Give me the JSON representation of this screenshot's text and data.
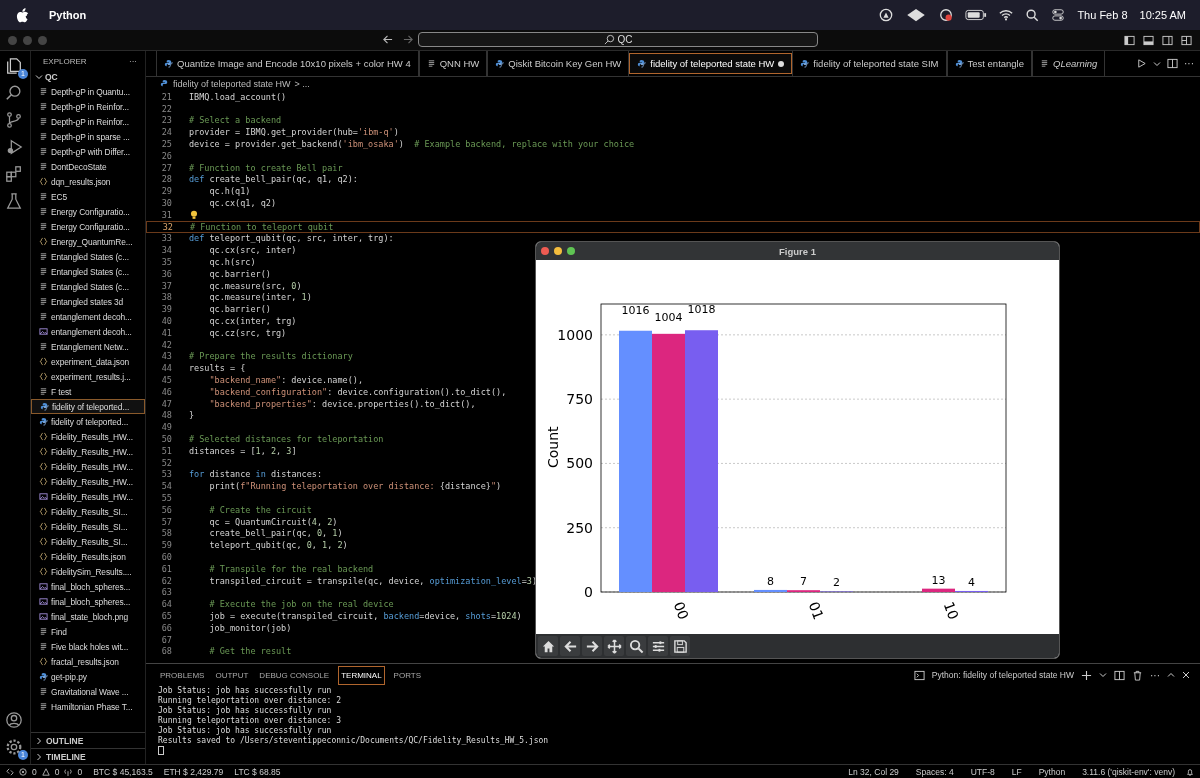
{
  "menubar": {
    "app": "Python",
    "date": "Thu Feb 8",
    "time": "10:25 AM"
  },
  "titlebar": {
    "search": "QC"
  },
  "activity_bar": {
    "explorer_badge": "1",
    "settings_badge": "1"
  },
  "explorer": {
    "title": "EXPLORER",
    "more": "···",
    "folder": "QC",
    "sections": [
      "OUTLINE",
      "TIMELINE"
    ],
    "items": [
      {
        "label": "Depth-ϱP in Quantu...",
        "kind": "file",
        "selected": false
      },
      {
        "label": "Depth-ϱP in Reinfor...",
        "kind": "file",
        "selected": false
      },
      {
        "label": "Depth-ϱP in Reinfor...",
        "kind": "file",
        "selected": false
      },
      {
        "label": "Depth-ϱP in sparse ...",
        "kind": "file",
        "selected": false
      },
      {
        "label": "Depth-ϱP with Differ...",
        "kind": "file",
        "selected": false
      },
      {
        "label": "DontDecoState",
        "kind": "file",
        "selected": false
      },
      {
        "label": "dqn_results.json",
        "kind": "json",
        "selected": false
      },
      {
        "label": "EC5",
        "kind": "file",
        "selected": false
      },
      {
        "label": "Energy Configuratio...",
        "kind": "file",
        "selected": false
      },
      {
        "label": "Energy Configuratio...",
        "kind": "file",
        "selected": false
      },
      {
        "label": "Energy_QuantumRe...",
        "kind": "json",
        "selected": false
      },
      {
        "label": "Entangled States (c...",
        "kind": "file",
        "selected": false
      },
      {
        "label": "Entangled States (c...",
        "kind": "file",
        "selected": false
      },
      {
        "label": "Entangled States (c...",
        "kind": "file",
        "selected": false
      },
      {
        "label": "Entangled states 3d",
        "kind": "file",
        "selected": false
      },
      {
        "label": "entanglement decoh...",
        "kind": "file",
        "selected": false
      },
      {
        "label": "entanglement decoh...",
        "kind": "image",
        "selected": false
      },
      {
        "label": "Entanglement Netw...",
        "kind": "file",
        "selected": false
      },
      {
        "label": "experiment_data.json",
        "kind": "json",
        "selected": false
      },
      {
        "label": "experiment_results.j...",
        "kind": "json",
        "selected": false
      },
      {
        "label": "F test",
        "kind": "file",
        "selected": false
      },
      {
        "label": "fidelity of teleported...",
        "kind": "python",
        "selected": true
      },
      {
        "label": "fidelity of teleported...",
        "kind": "python",
        "selected": false
      },
      {
        "label": "Fidelity_Results_HW...",
        "kind": "json",
        "selected": false
      },
      {
        "label": "Fidelity_Results_HW...",
        "kind": "json",
        "selected": false
      },
      {
        "label": "Fidelity_Results_HW...",
        "kind": "json",
        "selected": false
      },
      {
        "label": "Fidelity_Results_HW...",
        "kind": "json",
        "selected": false
      },
      {
        "label": "Fidelity_Results_HW...",
        "kind": "image",
        "selected": false
      },
      {
        "label": "Fidelity_Results_SI...",
        "kind": "json",
        "selected": false
      },
      {
        "label": "Fidelity_Results_SI...",
        "kind": "json",
        "selected": false
      },
      {
        "label": "Fidelity_Results_SI...",
        "kind": "json",
        "selected": false
      },
      {
        "label": "Fidelity_Results.json",
        "kind": "json",
        "selected": false
      },
      {
        "label": "FidelitySim_Results....",
        "kind": "json",
        "selected": false
      },
      {
        "label": "final_bloch_spheres...",
        "kind": "image",
        "selected": false
      },
      {
        "label": "final_bloch_spheres...",
        "kind": "image",
        "selected": false
      },
      {
        "label": "final_state_bloch.png",
        "kind": "image",
        "selected": false
      },
      {
        "label": "Find",
        "kind": "file",
        "selected": false
      },
      {
        "label": "Five black holes wit...",
        "kind": "file",
        "selected": false
      },
      {
        "label": "fractal_results.json",
        "kind": "json",
        "selected": false
      },
      {
        "label": "get-pip.py",
        "kind": "python",
        "selected": false
      },
      {
        "label": "Gravitational Wave ...",
        "kind": "file",
        "selected": false
      },
      {
        "label": "Hamiltonian Phase T...",
        "kind": "file",
        "selected": false
      }
    ]
  },
  "tabs": [
    {
      "label": "Quantize Image and Encode 10x10 pixels + color HW 4",
      "kind": "python",
      "selected": false,
      "modified": false,
      "preview": false
    },
    {
      "label": "QNN HW",
      "kind": "file",
      "selected": false,
      "modified": false,
      "preview": false
    },
    {
      "label": "Qiskit Bitcoin Key Gen HW",
      "kind": "python",
      "selected": false,
      "modified": false,
      "preview": false
    },
    {
      "label": "fidelity of teleported state HW",
      "kind": "python",
      "selected": true,
      "modified": true,
      "preview": false
    },
    {
      "label": "fidelity of teleported state SIM",
      "kind": "python",
      "selected": false,
      "modified": false,
      "preview": false
    },
    {
      "label": "Test entangle",
      "kind": "python",
      "selected": false,
      "modified": false,
      "preview": false
    },
    {
      "label": "QLearning",
      "kind": "file",
      "selected": false,
      "modified": false,
      "preview": true
    }
  ],
  "editor_more": "···",
  "breadcrumb": {
    "file": "fidelity of teleported state HW",
    "rest": "> ..."
  },
  "code": [
    {
      "number": "21",
      "current": false,
      "tokens": [
        {
          "kind": "plain",
          "text": "IBMQ.load_account()"
        }
      ]
    },
    {
      "number": "22",
      "current": false
    },
    {
      "number": "23",
      "current": false,
      "tokens": [
        {
          "kind": "comment",
          "text": "# Select a backend"
        }
      ]
    },
    {
      "number": "24",
      "current": false,
      "tokens": [
        {
          "kind": "plain",
          "text": "provider = IBMQ.get_provider(hub="
        },
        {
          "kind": "string",
          "text": "'ibm-q'"
        },
        {
          "kind": "plain",
          "text": ")"
        }
      ]
    },
    {
      "number": "25",
      "current": false,
      "tokens": [
        {
          "kind": "plain",
          "text": "device = provider.get_backend("
        },
        {
          "kind": "string",
          "text": "'ibm_osaka'"
        },
        {
          "kind": "plain",
          "text": ")  "
        },
        {
          "kind": "comment",
          "text": "# Example backend, replace with your choice"
        }
      ]
    },
    {
      "number": "26",
      "current": false
    },
    {
      "number": "27",
      "current": false,
      "tokens": [
        {
          "kind": "comment",
          "text": "# Function to create Bell pair"
        }
      ]
    },
    {
      "number": "28",
      "current": false,
      "tokens": [
        {
          "kind": "keyword",
          "text": "def "
        },
        {
          "kind": "plain",
          "text": "create_bell_pair(qc, q1, q2):"
        }
      ]
    },
    {
      "number": "29",
      "current": false,
      "tokens": [
        {
          "kind": "plain",
          "text": "    qc.h(q1)"
        }
      ]
    },
    {
      "number": "30",
      "current": false,
      "tokens": [
        {
          "kind": "plain",
          "text": "    qc.cx(q1, q2)"
        }
      ]
    },
    {
      "number": "31",
      "current": false,
      "bulb": true
    },
    {
      "number": "32",
      "current": true,
      "tokens": [
        {
          "kind": "comment",
          "text": "# Function to teleport qubit"
        }
      ]
    },
    {
      "number": "33",
      "current": false,
      "tokens": [
        {
          "kind": "keyword",
          "text": "def "
        },
        {
          "kind": "plain",
          "text": "teleport_qubit(qc, src, inter, trg):"
        }
      ]
    },
    {
      "number": "34",
      "current": false,
      "tokens": [
        {
          "kind": "plain",
          "text": "    qc.cx(src, inter)"
        }
      ]
    },
    {
      "number": "35",
      "current": false,
      "tokens": [
        {
          "kind": "plain",
          "text": "    qc.h(src)"
        }
      ]
    },
    {
      "number": "36",
      "current": false,
      "tokens": [
        {
          "kind": "plain",
          "text": "    qc.barrier()"
        }
      ]
    },
    {
      "number": "37",
      "current": false,
      "tokens": [
        {
          "kind": "plain",
          "text": "    qc.measure(src, "
        },
        {
          "kind": "number",
          "text": "0"
        },
        {
          "kind": "plain",
          "text": ")"
        }
      ]
    },
    {
      "number": "38",
      "current": false,
      "tokens": [
        {
          "kind": "plain",
          "text": "    qc.measure(inter, "
        },
        {
          "kind": "number",
          "text": "1"
        },
        {
          "kind": "plain",
          "text": ")"
        }
      ]
    },
    {
      "number": "39",
      "current": false,
      "tokens": [
        {
          "kind": "plain",
          "text": "    qc.barrier()"
        }
      ]
    },
    {
      "number": "40",
      "current": false,
      "tokens": [
        {
          "kind": "plain",
          "text": "    qc.cx(inter, trg)"
        }
      ]
    },
    {
      "number": "41",
      "current": false,
      "tokens": [
        {
          "kind": "plain",
          "text": "    qc.cz(src, trg)"
        }
      ]
    },
    {
      "number": "42",
      "current": false
    },
    {
      "number": "43",
      "current": false,
      "tokens": [
        {
          "kind": "comment",
          "text": "# Prepare the results dictionary"
        }
      ]
    },
    {
      "number": "44",
      "current": false,
      "tokens": [
        {
          "kind": "plain",
          "text": "results = {"
        }
      ]
    },
    {
      "number": "45",
      "current": false,
      "tokens": [
        {
          "kind": "string",
          "text": "    \"backend_name\""
        },
        {
          "kind": "plain",
          "text": ": device.name(),"
        }
      ]
    },
    {
      "number": "46",
      "current": false,
      "tokens": [
        {
          "kind": "string",
          "text": "    \"backend_configuration\""
        },
        {
          "kind": "plain",
          "text": ": device.configuration().to_dict(),"
        }
      ]
    },
    {
      "number": "47",
      "current": false,
      "tokens": [
        {
          "kind": "string",
          "text": "    \"backend_properties\""
        },
        {
          "kind": "plain",
          "text": ": device.properties().to_dict(),"
        }
      ]
    },
    {
      "number": "48",
      "current": false,
      "tokens": [
        {
          "kind": "plain",
          "text": "}"
        }
      ]
    },
    {
      "number": "49",
      "current": false
    },
    {
      "number": "50",
      "current": false,
      "tokens": [
        {
          "kind": "comment",
          "text": "# Selected distances for teleportation"
        }
      ]
    },
    {
      "number": "51",
      "current": false,
      "tokens": [
        {
          "kind": "plain",
          "text": "distances = ["
        },
        {
          "kind": "number",
          "text": "1"
        },
        {
          "kind": "plain",
          "text": ", "
        },
        {
          "kind": "number",
          "text": "2"
        },
        {
          "kind": "plain",
          "text": ", "
        },
        {
          "kind": "number",
          "text": "3"
        },
        {
          "kind": "plain",
          "text": "]"
        }
      ]
    },
    {
      "number": "52",
      "current": false
    },
    {
      "number": "53",
      "current": false,
      "tokens": [
        {
          "kind": "keyword",
          "text": "for "
        },
        {
          "kind": "plain",
          "text": "distance "
        },
        {
          "kind": "keyword",
          "text": "in "
        },
        {
          "kind": "plain",
          "text": "distances:"
        }
      ]
    },
    {
      "number": "54",
      "current": false,
      "tokens": [
        {
          "kind": "plain",
          "text": "    print("
        },
        {
          "kind": "string",
          "text": "f\"Running teleportation over distance: "
        },
        {
          "kind": "plain",
          "text": "{distance}"
        },
        {
          "kind": "string",
          "text": "\""
        },
        {
          "kind": "plain",
          "text": ")"
        }
      ]
    },
    {
      "number": "55",
      "current": false
    },
    {
      "number": "56",
      "current": false,
      "tokens": [
        {
          "kind": "comment",
          "text": "    # Create the circuit"
        }
      ]
    },
    {
      "number": "57",
      "current": false,
      "tokens": [
        {
          "kind": "plain",
          "text": "    qc = QuantumCircuit("
        },
        {
          "kind": "number",
          "text": "4"
        },
        {
          "kind": "plain",
          "text": ", "
        },
        {
          "kind": "number",
          "text": "2"
        },
        {
          "kind": "plain",
          "text": ")"
        }
      ]
    },
    {
      "number": "58",
      "current": false,
      "tokens": [
        {
          "kind": "plain",
          "text": "    create_bell_pair(qc, "
        },
        {
          "kind": "number",
          "text": "0"
        },
        {
          "kind": "plain",
          "text": ", "
        },
        {
          "kind": "number",
          "text": "1"
        },
        {
          "kind": "plain",
          "text": ")"
        }
      ]
    },
    {
      "number": "59",
      "current": false,
      "tokens": [
        {
          "kind": "plain",
          "text": "    teleport_qubit(qc, "
        },
        {
          "kind": "number",
          "text": "0"
        },
        {
          "kind": "plain",
          "text": ", "
        },
        {
          "kind": "number",
          "text": "1"
        },
        {
          "kind": "plain",
          "text": ", "
        },
        {
          "kind": "number",
          "text": "2"
        },
        {
          "kind": "plain",
          "text": ")"
        }
      ]
    },
    {
      "number": "60",
      "current": false
    },
    {
      "number": "61",
      "current": false,
      "tokens": [
        {
          "kind": "comment",
          "text": "    # Transpile for the real backend"
        }
      ]
    },
    {
      "number": "62",
      "current": false,
      "tokens": [
        {
          "kind": "plain",
          "text": "    transpiled_circuit = transpile(qc, device, "
        },
        {
          "kind": "keyword",
          "text": "optimization_level"
        },
        {
          "kind": "plain",
          "text": "="
        },
        {
          "kind": "number",
          "text": "3"
        },
        {
          "kind": "plain",
          "text": ")"
        }
      ]
    },
    {
      "number": "63",
      "current": false
    },
    {
      "number": "64",
      "current": false,
      "tokens": [
        {
          "kind": "comment",
          "text": "    # Execute the job on the real device"
        }
      ]
    },
    {
      "number": "65",
      "current": false,
      "tokens": [
        {
          "kind": "plain",
          "text": "    job = execute(transpiled_circuit, "
        },
        {
          "kind": "keyword",
          "text": "backend"
        },
        {
          "kind": "plain",
          "text": "=device, "
        },
        {
          "kind": "keyword",
          "text": "shots"
        },
        {
          "kind": "plain",
          "text": "="
        },
        {
          "kind": "number",
          "text": "1024"
        },
        {
          "kind": "plain",
          "text": ")"
        }
      ]
    },
    {
      "number": "66",
      "current": false,
      "tokens": [
        {
          "kind": "plain",
          "text": "    job_monitor(job)"
        }
      ]
    },
    {
      "number": "67",
      "current": false
    },
    {
      "number": "68",
      "current": false,
      "tokens": [
        {
          "kind": "comment",
          "text": "    # Get the result"
        }
      ]
    }
  ],
  "figure": {
    "title": "Figure 1",
    "chart_data": {
      "type": "bar",
      "ylabel": "Count",
      "categories": [
        "00",
        "01",
        "10"
      ],
      "series": [
        {
          "color": "#648fff",
          "values": [
            1016,
            8,
            null
          ]
        },
        {
          "color": "#dc267f",
          "values": [
            1004,
            7,
            13
          ]
        },
        {
          "color": "#785ef0",
          "values": [
            1018,
            2,
            4
          ]
        }
      ],
      "ylim": [
        0,
        1120
      ],
      "yticks": [
        0,
        250,
        500,
        750,
        1000
      ],
      "grid": true,
      "data_labels": true
    }
  },
  "panel": {
    "tabs": [
      {
        "label": "PROBLEMS",
        "selected": false
      },
      {
        "label": "OUTPUT",
        "selected": false
      },
      {
        "label": "DEBUG CONSOLE",
        "selected": false
      },
      {
        "label": "TERMINAL",
        "selected": true
      },
      {
        "label": "PORTS",
        "selected": false
      }
    ],
    "terminal_name": "Python: fidelity of teleported state HW",
    "more": "···",
    "lines": [
      "Job Status: job has successfully run",
      "Running teleportation over distance: 2",
      "Job Status: job has successfully run",
      "Running teleportation over distance: 3",
      "Job Status: job has successfully run",
      "Results saved to /Users/steventippeconnic/Documents/QC/Fidelity_Results_HW_5.json"
    ]
  },
  "status_bar": {
    "errors": "0",
    "warnings": "0",
    "ports": "0",
    "left": [
      "BTC $ 45,163.5",
      "ETH $ 2,429.79",
      "LTC $ 68.85"
    ],
    "right": [
      "Ln 32, Col 29",
      "Spaces: 4",
      "UTF-8",
      "LF",
      "Python",
      "3.11.6 ('qiskit-env': venv)"
    ]
  }
}
